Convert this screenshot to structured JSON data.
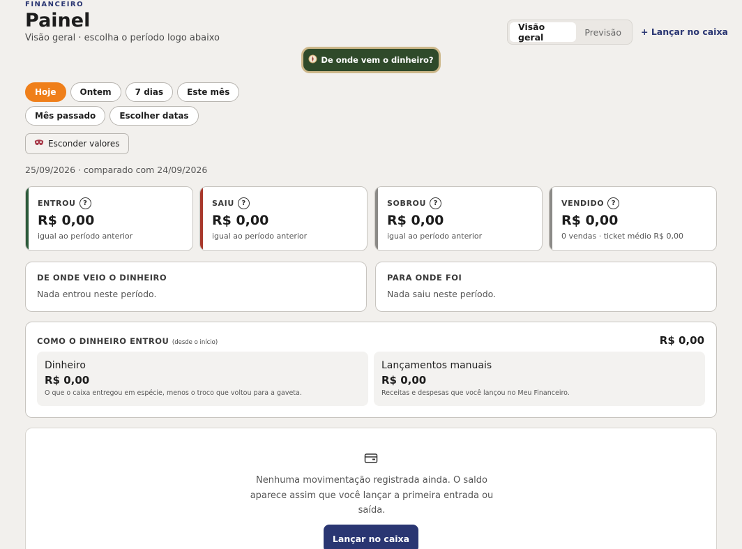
{
  "header": {
    "eyebrow": "FINANCEIRO",
    "title": "Painel",
    "subtitle": "Visão geral · escolha o período logo abaixo"
  },
  "view_toggle": {
    "items": [
      "Visão geral",
      "Previsão"
    ],
    "selected": "Visão geral"
  },
  "add_cash_link": "+ Lançar no caixa",
  "origin_button": {
    "icon": "compass-icon",
    "label": "De onde vem o dinheiro?"
  },
  "periods": {
    "items": [
      "Hoje",
      "Ontem",
      "7 dias",
      "Este mês",
      "Mês passado",
      "Escolher datas"
    ],
    "selected": "Hoje"
  },
  "hide_values": {
    "icon": "mask-icon",
    "label": "Esconder valores"
  },
  "comparison": "25/09/2026 · comparado com 24/09/2026",
  "kpis": [
    {
      "label": "ENTROU",
      "value": "R$ 0,00",
      "note": "igual ao período anterior",
      "accent": "#2c5a3a"
    },
    {
      "label": "SAIU",
      "value": "R$ 0,00",
      "note": "igual ao período anterior",
      "accent": "#a8382c"
    },
    {
      "label": "SOBROU",
      "value": "R$ 0,00",
      "note": "igual ao período anterior",
      "accent": "#8b8a87"
    },
    {
      "label": "VENDIDO",
      "value": "R$ 0,00",
      "note": "0 vendas · ticket médio R$ 0,00",
      "accent": "#8b8a87"
    }
  ],
  "help_glyph": "?",
  "flows": [
    {
      "title": "DE ONDE VEIO O DINHEIRO",
      "text": "Nada entrou neste período."
    },
    {
      "title": "PARA ONDE FOI",
      "text": "Nada saiu neste período."
    }
  ],
  "how": {
    "title": "COMO O DINHEIRO ENTROU",
    "qualifier": "(desde o início)",
    "total": "R$ 0,00",
    "cards": [
      {
        "label": "Dinheiro",
        "value": "R$ 0,00",
        "note": "O que o caixa entregou em espécie, menos o troco que voltou para a gaveta."
      },
      {
        "label": "Lançamentos manuais",
        "value": "R$ 0,00",
        "note": "Receitas e despesas que você lançou no Meu Financeiro."
      }
    ]
  },
  "empty_state": {
    "icon": "wallet-icon",
    "text": "Nenhuma movimentação registrada ainda. O saldo aparece assim que você lançar a primeira entrada ou saída.",
    "button": "Lançar no caixa"
  },
  "colors": {
    "brand_navy": "#2a3672",
    "active_orange": "#ef7f1a",
    "origin_green": "#2f4a2a",
    "origin_gold": "#cdb88a"
  }
}
